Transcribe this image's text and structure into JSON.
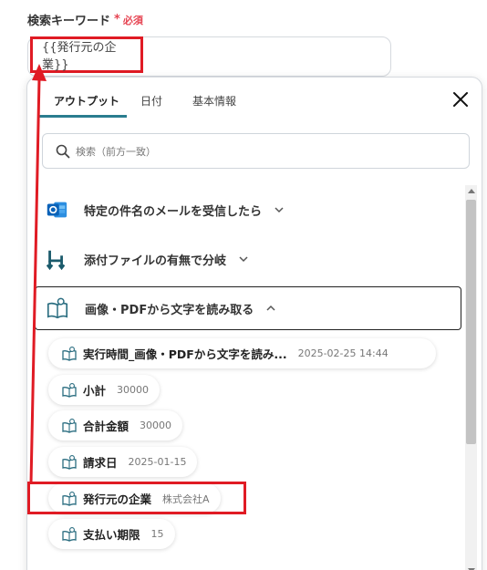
{
  "field": {
    "label": "検索キーワード",
    "required_mark": "*",
    "required_text": "必須",
    "value": "{{発行元の企業}}"
  },
  "tabs": [
    {
      "label": "アウトプット",
      "active": true
    },
    {
      "label": "日付",
      "active": false
    },
    {
      "label": "基本情報",
      "active": false
    }
  ],
  "search": {
    "placeholder": "検索（前方一致）"
  },
  "sections": [
    {
      "label": "特定の件名のメールを受信したら",
      "icon": "outlook-icon",
      "expanded": false
    },
    {
      "label": "添付ファイルの有無で分岐",
      "icon": "branch-icon",
      "expanded": false
    },
    {
      "label": "画像・PDFから文字を読み取る",
      "icon": "ocr-book-icon",
      "expanded": true
    }
  ],
  "items": [
    {
      "name": "実行時間_画像・PDFから文字を読み...",
      "value": "2025-02-25 14:44"
    },
    {
      "name": "小計",
      "value": "30000"
    },
    {
      "name": "合計金額",
      "value": "30000"
    },
    {
      "name": "請求日",
      "value": "2025-01-15"
    },
    {
      "name": "発行元の企業",
      "value": "株式会社A"
    },
    {
      "name": "支払い期限",
      "value": "15"
    }
  ],
  "colors": {
    "accent_tab": "#2a7d8f",
    "highlight": "#e01b24",
    "required": "#e64452"
  }
}
